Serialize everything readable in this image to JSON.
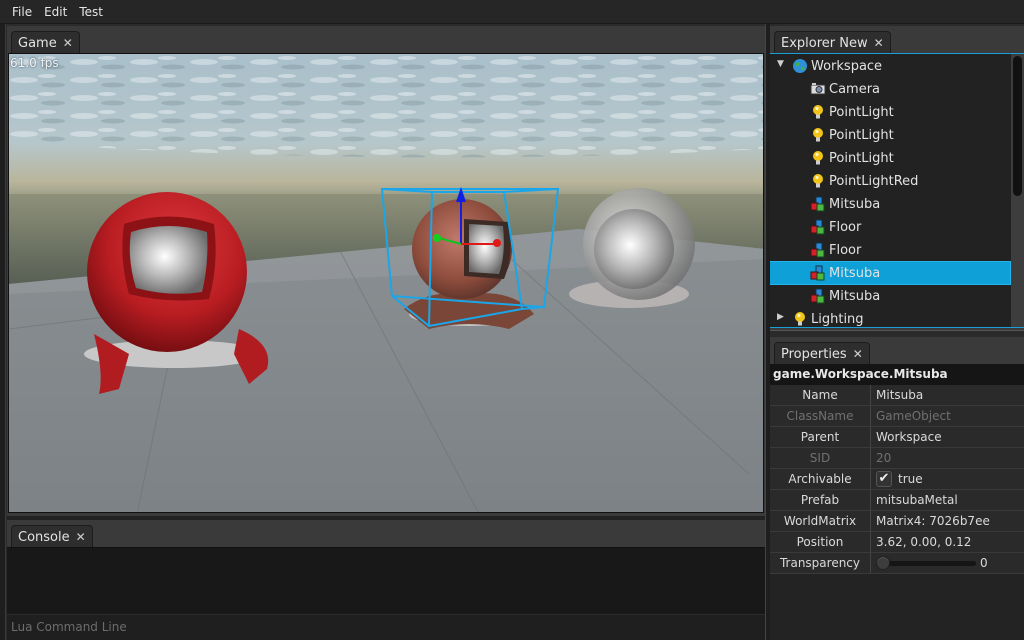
{
  "menubar": {
    "items": [
      "File",
      "Edit",
      "Test"
    ]
  },
  "game": {
    "tab_label": "Game",
    "fps": "61.0 fps",
    "selection_color": "#1aa6e8"
  },
  "console": {
    "tab_label": "Console",
    "command_placeholder": "Lua Command Line"
  },
  "explorer": {
    "tab_label": "Explorer New",
    "accent": "#0ea0d6",
    "items": [
      {
        "label": "Workspace",
        "icon": "globe-icon",
        "depth": 0,
        "expander": "expanded"
      },
      {
        "label": "Camera",
        "icon": "camera-icon",
        "depth": 1
      },
      {
        "label": "PointLight",
        "icon": "light-bulb-icon",
        "depth": 1
      },
      {
        "label": "PointLight",
        "icon": "light-bulb-icon",
        "depth": 1
      },
      {
        "label": "PointLight",
        "icon": "light-bulb-icon",
        "depth": 1
      },
      {
        "label": "PointLightRed",
        "icon": "light-bulb-icon",
        "depth": 1
      },
      {
        "label": "Mitsuba",
        "icon": "game-object-icon",
        "depth": 1
      },
      {
        "label": "Floor",
        "icon": "game-object-icon",
        "depth": 1
      },
      {
        "label": "Floor",
        "icon": "game-object-icon",
        "depth": 1
      },
      {
        "label": "Mitsuba",
        "icon": "game-object-icon",
        "depth": 1,
        "selected": true
      },
      {
        "label": "Mitsuba",
        "icon": "game-object-icon",
        "depth": 1
      },
      {
        "label": "Lighting",
        "icon": "light-bulb-icon",
        "depth": 0,
        "expander": "collapsed"
      }
    ]
  },
  "properties": {
    "tab_label": "Properties",
    "path": "game.Workspace.Mitsuba",
    "rows": [
      {
        "name": "Name",
        "value": "Mitsuba",
        "readonly": false
      },
      {
        "name": "ClassName",
        "value": "GameObject",
        "readonly": true
      },
      {
        "name": "Parent",
        "value": "Workspace",
        "readonly": false
      },
      {
        "name": "SID",
        "value": "20",
        "readonly": true
      },
      {
        "name": "Archivable",
        "value": "true",
        "type": "checkbox",
        "checked": true
      },
      {
        "name": "Prefab",
        "value": "mitsubaMetal",
        "readonly": false
      },
      {
        "name": "WorldMatrix",
        "value": "Matrix4: 7026b7ee",
        "readonly": false
      },
      {
        "name": "Position",
        "value": "3.62, 0.00, 0.12",
        "readonly": false
      },
      {
        "name": "Transparency",
        "value": "0",
        "type": "slider",
        "fraction": 0
      }
    ]
  }
}
